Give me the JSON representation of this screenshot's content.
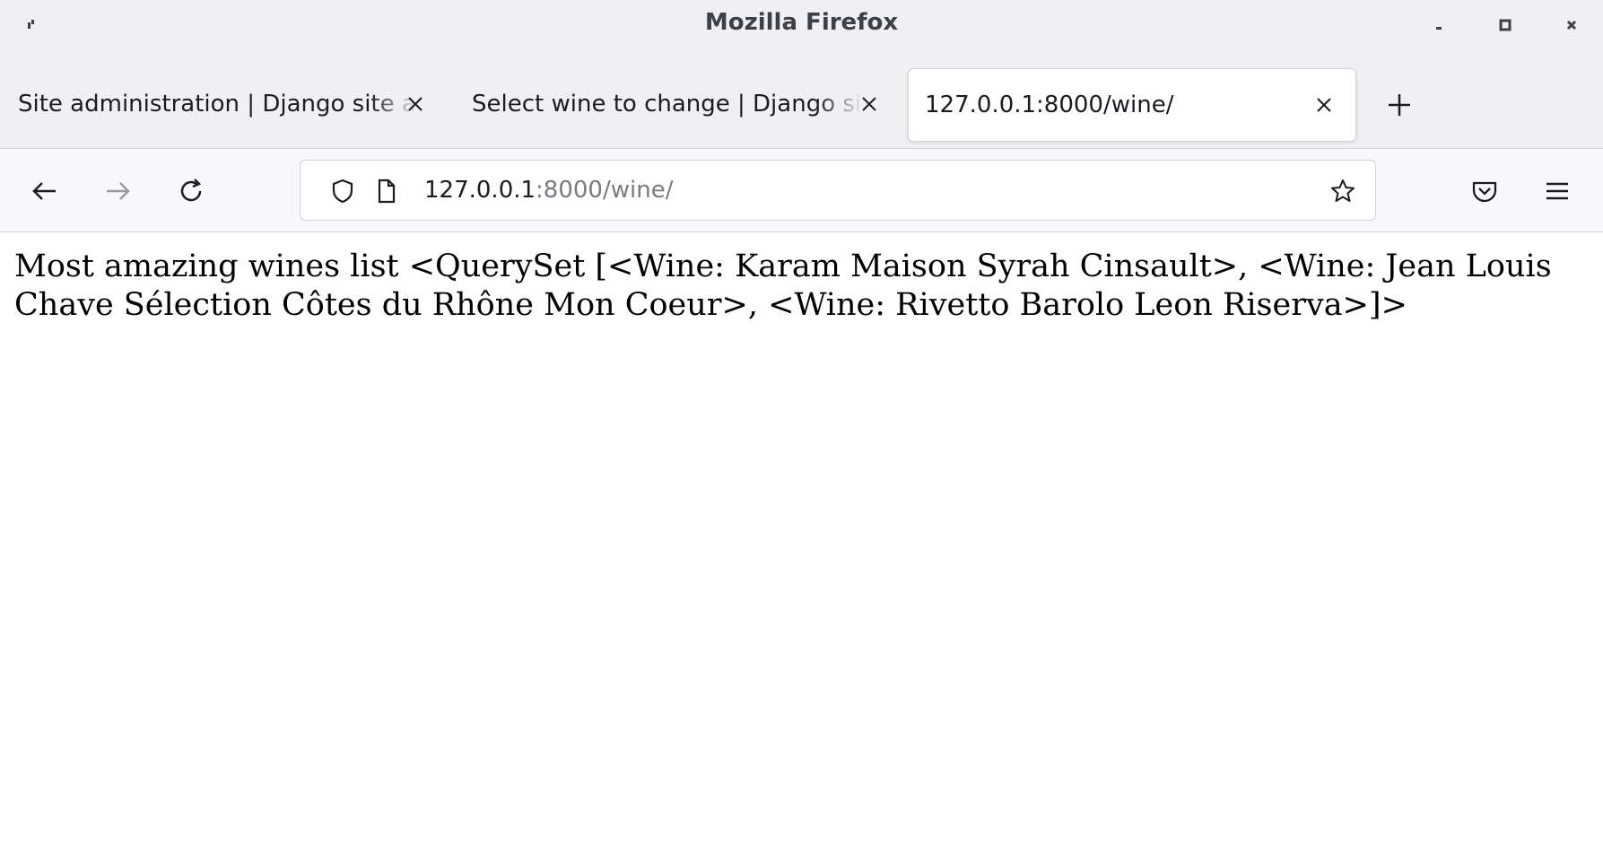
{
  "window": {
    "title": "Mozilla Firefox",
    "controls": [
      "minimize-icon",
      "maximize-icon",
      "close-icon"
    ]
  },
  "tabs": [
    {
      "label": "Site administration | Django site admin",
      "active": false
    },
    {
      "label": "Select wine to change | Django site admin",
      "active": false
    },
    {
      "label": "127.0.0.1:8000/wine/",
      "active": true
    }
  ],
  "navbar": {
    "url_host": "127.0.0.1",
    "url_rest": ":8000/wine/",
    "icons": [
      "back-arrow-icon",
      "forward-arrow-icon",
      "reload-icon",
      "shield-icon",
      "page-icon",
      "star-icon",
      "pocket-icon",
      "menu-icon"
    ]
  },
  "page": {
    "text": "Most amazing wines list <QuerySet [<Wine: Karam Maison Syrah Cinsault>, <Wine: Jean Louis Chave Sélection Côtes du Rhône Mon Coeur>, <Wine: Rivetto Barolo Leon Riserva>]>"
  },
  "colors": {
    "chrome_bg": "#f0f0f4",
    "navbar_bg": "#f9f9fb",
    "title_text": "#3d4147",
    "url_dim": "#7a7a80"
  }
}
